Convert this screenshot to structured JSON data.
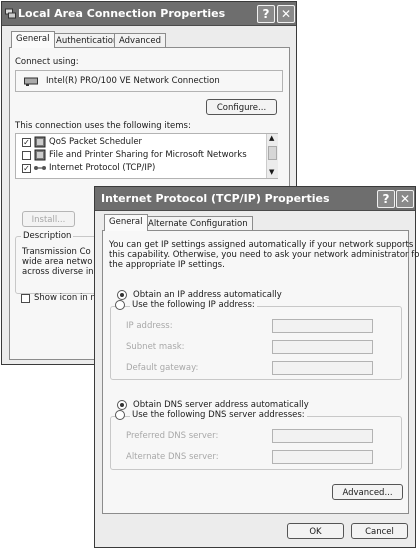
{
  "lan": {
    "title": "Local Area Connection Properties",
    "help": "?",
    "close": "✕",
    "tabs": [
      "General",
      "Authentication",
      "Advanced"
    ],
    "connect_using_label": "Connect using:",
    "adapter": "Intel(R) PRO/100 VE Network Connection",
    "configure": "Configure...",
    "items_label": "This connection uses the following items:",
    "items": [
      {
        "label": "QoS Packet Scheduler",
        "checked": true
      },
      {
        "label": "File and Printer Sharing for Microsoft Networks",
        "checked": false
      },
      {
        "label": "Internet Protocol (TCP/IP)",
        "checked": true
      }
    ],
    "install": "Install...",
    "description_label": "Description",
    "description_lines": [
      "Transmission Co",
      "wide area netwo",
      "across diverse in"
    ],
    "show_icon": "Show icon in no"
  },
  "tcp": {
    "title": "Internet Protocol (TCP/IP) Properties",
    "help": "?",
    "close": "✕",
    "tabs": [
      "General",
      "Alternate Configuration"
    ],
    "intro": [
      "You can get IP settings assigned automatically if your network supports",
      "this capability. Otherwise, you need to ask your network administrator for",
      "the appropriate IP settings."
    ],
    "obtain_ip": "Obtain an IP address automatically",
    "use_ip": "Use the following IP address:",
    "ip_address": "IP address:",
    "subnet_mask": "Subnet mask:",
    "default_gateway": "Default gateway:",
    "obtain_dns": "Obtain DNS server address automatically",
    "use_dns": "Use the following DNS server addresses:",
    "preferred_dns": "Preferred DNS server:",
    "alternate_dns": "Alternate DNS server:",
    "advanced": "Advanced...",
    "ok": "OK",
    "cancel": "Cancel"
  }
}
